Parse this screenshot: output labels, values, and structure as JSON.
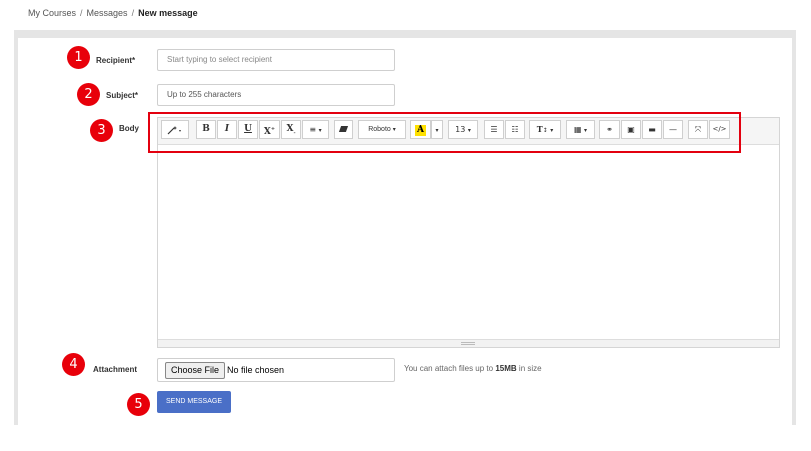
{
  "breadcrumb": {
    "items": [
      "My Courses",
      "Messages"
    ],
    "current": "New message"
  },
  "form": {
    "recipient": {
      "label": "Recipient*",
      "placeholder": "Start typing to select recipient"
    },
    "subject": {
      "label": "Subject*",
      "placeholder": "Up to 255 characters"
    },
    "body": {
      "label": "Body",
      "content": ""
    },
    "attachment": {
      "label": "Attachment",
      "choose_label": "Choose File",
      "status": "No file chosen",
      "hint_prefix": "You can attach files up to",
      "hint_size": "15MB",
      "hint_suffix": "in size"
    },
    "send_label": "SEND MESSAGE"
  },
  "toolbar": {
    "bold": "B",
    "italic": "I",
    "underline": "U",
    "superscript": "X",
    "subscript": "X",
    "font_name": "Roboto",
    "highlight": "A",
    "font_size": "13",
    "text_size": "T"
  },
  "annotations": [
    "1",
    "2",
    "3",
    "4",
    "5"
  ],
  "colors": {
    "accent_button": "#4a6fc7",
    "annotation": "#e8000a",
    "highlight_swatch": "#ffe100"
  }
}
